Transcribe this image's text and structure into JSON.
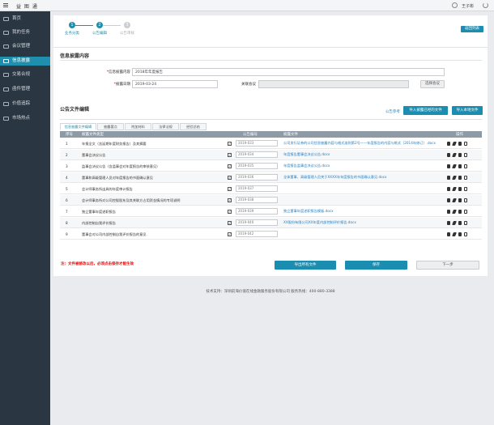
{
  "topbar": {
    "brand": "益 图 通",
    "user": "王子彬"
  },
  "sidebar": {
    "items": [
      {
        "label": "首页",
        "icon": "home-icon"
      },
      {
        "label": "我的任务",
        "icon": "task-icon"
      },
      {
        "label": "会议管理",
        "icon": "meeting-icon"
      },
      {
        "label": "信息披露",
        "icon": "disclosure-icon",
        "active": true
      },
      {
        "label": "交易合规",
        "icon": "trade-icon"
      },
      {
        "label": "函件管理",
        "icon": "letter-icon"
      },
      {
        "label": "价值追踪",
        "icon": "value-icon"
      },
      {
        "label": "市场热点",
        "icon": "market-icon"
      }
    ]
  },
  "steps": [
    {
      "num": "1",
      "label": "业务分类",
      "done": true
    },
    {
      "num": "2",
      "label": "公告编辑",
      "done": true
    },
    {
      "num": "3",
      "label": "公告审核",
      "done": false
    }
  ],
  "return_button": "返回列表",
  "info_section": {
    "title": "信息披露内容",
    "content_label": "信息披露内容",
    "content_value": "2018年年度报告",
    "date_label": "披露日期",
    "date_value": "2019-03-24",
    "meeting_label": "关联会议",
    "meeting_value": "",
    "select_meeting_button": "选择会议"
  },
  "file_section": {
    "title": "公告文件编辑",
    "reference_link": "公告参考",
    "import_linked_button": "导入披露已经的文件",
    "import_local_button": "导入本地文件"
  },
  "tabs": [
    "信息披露文件编辑",
    "披露要点",
    "附加材料",
    "法律法规",
    "经验总结"
  ],
  "table": {
    "headers": {
      "index": "序号",
      "type": "披露文件类型",
      "number": "公告编号",
      "file": "披露文件",
      "ops": "操作"
    },
    "rows": [
      {
        "index": "1",
        "type": "年报全文（含延期年度财务报告）及其摘要",
        "checked": true,
        "number": "2019-033",
        "file": "公司发行证券的公司信息披露内容与格式准则第2号——年度报告的内容与格式（2014年修订）.docx"
      },
      {
        "index": "2",
        "type": "董事会决议公告",
        "checked": true,
        "number": "2019-034",
        "file": "年度报告董事会决议公告.docx"
      },
      {
        "index": "3",
        "type": "监事会决议公告（含监事会对年度报告的审核意见）",
        "checked": true,
        "number": "2019-035",
        "file": "年度报告监事会决议公告.docx"
      },
      {
        "index": "4",
        "type": "董事和高级管理人员对年度报告的书面确认意见",
        "checked": true,
        "number": "2019-036",
        "file": "全体董事、高级管理人员关于XXXX年年度报告的书面确认意见.docx"
      },
      {
        "index": "5",
        "type": "会计师事务所出具的年度审计报告",
        "checked": true,
        "number": "2019-037",
        "file": ""
      },
      {
        "index": "6",
        "type": "会计师事务所对公司控股股东及其关联方占用资金情况的专项说明",
        "checked": true,
        "number": "2019-038",
        "file": ""
      },
      {
        "index": "7",
        "type": "独立董事年度述职报告",
        "checked": true,
        "number": "2019-039",
        "file": "独立董事年度述职报告模板.docx"
      },
      {
        "index": "8",
        "type": "内部控制自我评价报告",
        "checked": true,
        "number": "2019-040",
        "file": "XX股份有限公司XX年度内部控制评价报告.docx"
      },
      {
        "index": "9",
        "type": "董事会对公司内部控制自我评价报告的意见",
        "checked": true,
        "number": "2019-042",
        "file": ""
      }
    ]
  },
  "note": "注：文件被修改以后，必须点击保存才能生效",
  "actions": {
    "export": "导出所有文件",
    "save": "保存",
    "next": "下一步"
  },
  "footer": "技术支持：深圳前海价值在线金融服务股份有限公司  服务热线：400-880-3388"
}
